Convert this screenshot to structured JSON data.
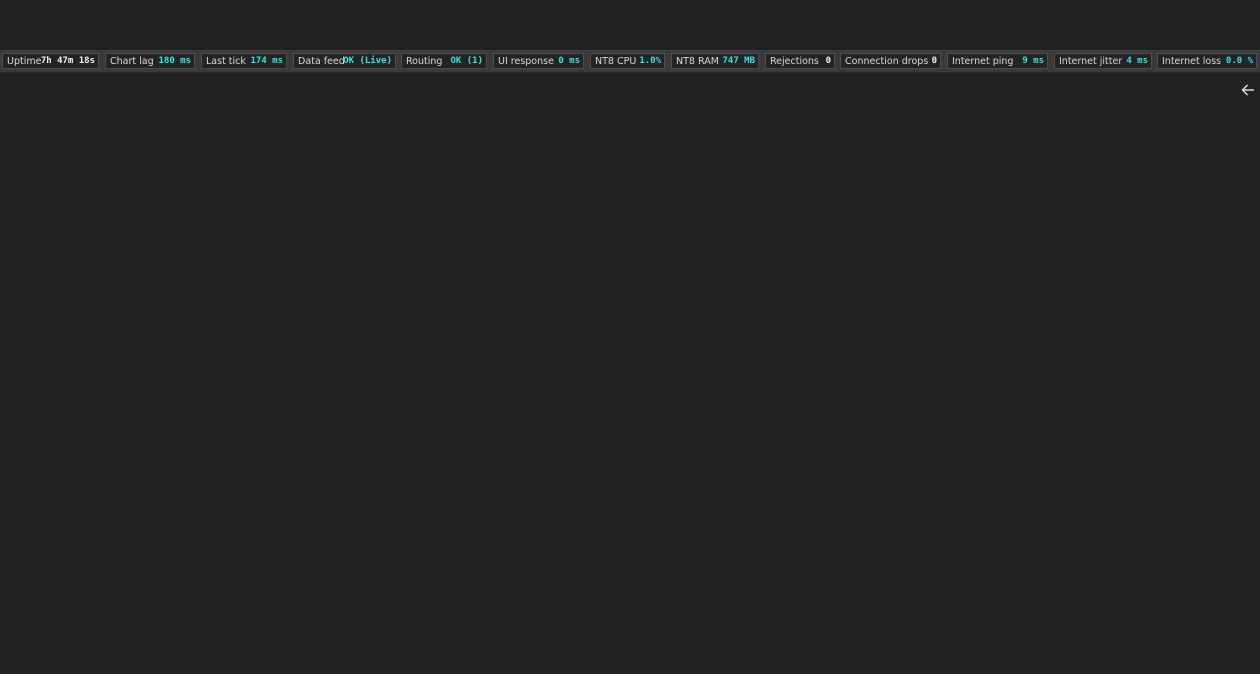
{
  "status_bar": {
    "metrics": [
      {
        "label": "Uptime",
        "value": "7h 47m 18s",
        "value_color": "#f2f2f2"
      },
      {
        "label": "Chart lag",
        "value": "180 ms",
        "value_color": "#2ee6e6"
      },
      {
        "label": "Last tick",
        "value": "174 ms",
        "value_color": "#2ee6e6"
      },
      {
        "label": "Data feed",
        "value": "OK (Live)",
        "value_color": "#2ee6e6"
      },
      {
        "label": "Routing",
        "value": "OK (1)",
        "value_color": "#2ee6e6"
      },
      {
        "label": "UI response",
        "value": "0 ms",
        "value_color": "#2ee6e6"
      },
      {
        "label": "NT8 CPU",
        "value": "1.0%",
        "value_color": "#2ee6e6"
      },
      {
        "label": "NT8 RAM",
        "value": "747 MB",
        "value_color": "#2ee6e6"
      },
      {
        "label": "Rejections",
        "value": "0",
        "value_color": "#f2f2f2"
      },
      {
        "label": "Connection drops",
        "value": "0",
        "value_color": "#f2f2f2"
      },
      {
        "label": "Internet ping",
        "value": "9 ms",
        "value_color": "#2ee6e6"
      },
      {
        "label": "Internet jitter",
        "value": "4 ms",
        "value_color": "#2ee6e6"
      },
      {
        "label": "Internet loss",
        "value": "0.0 %",
        "value_color": "#2ee6e6"
      }
    ]
  },
  "icons": {
    "back": "arrow-left-icon"
  }
}
